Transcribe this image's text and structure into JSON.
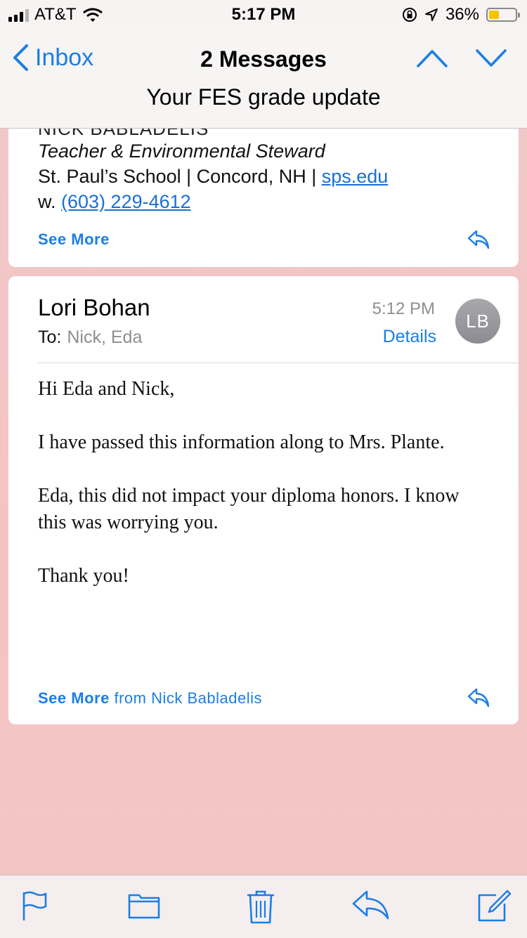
{
  "status": {
    "carrier": "AT&T",
    "time": "5:17 PM",
    "battery": "36%",
    "battery_level": 0.36
  },
  "nav": {
    "back_label": "Inbox",
    "title": "2 Messages",
    "subject": "Your FES grade update"
  },
  "message1": {
    "sig_name": "NICK BABLADELIS",
    "sig_title": "Teacher & Environmental Steward",
    "sig_school": "St. Paul’s School | Concord, NH | ",
    "sig_site": "sps.edu",
    "sig_phone_prefix": "w. ",
    "sig_phone": "(603) 229-4612",
    "see_more": "See More"
  },
  "message2": {
    "sender": "Lori Bohan",
    "to_label": "To:",
    "to_names": "Nick, Eda",
    "time": "5:12 PM",
    "details": "Details",
    "avatar": "LB",
    "body": [
      "Hi Eda and Nick,",
      "I have passed this information along to Mrs. Plante.",
      "Eda, this did not impact your diploma honors.  I know this was worrying you.",
      "Thank you!"
    ],
    "see_more": "See More",
    "see_more_from": "from Nick Babladelis"
  },
  "toolbar": {
    "icons": [
      "flag-icon",
      "folder-icon",
      "trash-icon",
      "reply-icon",
      "compose-icon"
    ]
  },
  "colors": {
    "accent": "#1a7ee6",
    "background": "#f4c4c4"
  }
}
